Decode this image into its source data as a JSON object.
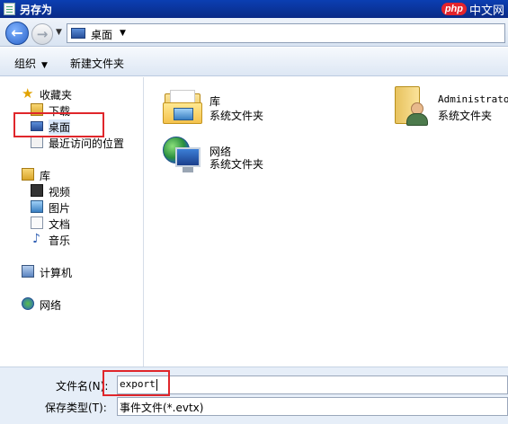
{
  "window": {
    "title": "另存为"
  },
  "watermark": {
    "badge": "php",
    "text": "中文网"
  },
  "address": {
    "location": "桌面",
    "icons": [
      "back-arrow-icon",
      "forward-arrow-icon",
      "desktop-icon"
    ]
  },
  "toolbar": {
    "organize": "组织",
    "new_folder": "新建文件夹"
  },
  "nav": {
    "favorites": {
      "label": "收藏夹",
      "items": [
        {
          "label": "下载",
          "icon": "download-folder-icon"
        },
        {
          "label": "桌面",
          "icon": "desktop-icon",
          "selected": true
        },
        {
          "label": "最近访问的位置",
          "icon": "recent-places-icon"
        }
      ]
    },
    "libraries": {
      "label": "库",
      "items": [
        {
          "label": "视频",
          "icon": "video-icon"
        },
        {
          "label": "图片",
          "icon": "pictures-icon"
        },
        {
          "label": "文档",
          "icon": "documents-icon"
        },
        {
          "label": "音乐",
          "icon": "music-icon"
        }
      ]
    },
    "computer": {
      "label": "计算机"
    },
    "network": {
      "label": "网络"
    }
  },
  "content": {
    "items": [
      {
        "name": "库",
        "type": "系统文件夹",
        "icon": "library-folder-icon"
      },
      {
        "name": "Administrator",
        "type": "系统文件夹",
        "icon": "user-folder-icon"
      },
      {
        "name": "网络",
        "type": "系统文件夹",
        "icon": "network-icon"
      }
    ]
  },
  "form": {
    "filename_label": "文件名(N):",
    "filename_value": "export",
    "filetype_label": "保存类型(T):",
    "filetype_value": "事件文件(*.evtx)"
  },
  "colors": {
    "highlight": "#e0262b",
    "titlebar": "#0b3fb2",
    "selection": "#d9e8fb"
  }
}
